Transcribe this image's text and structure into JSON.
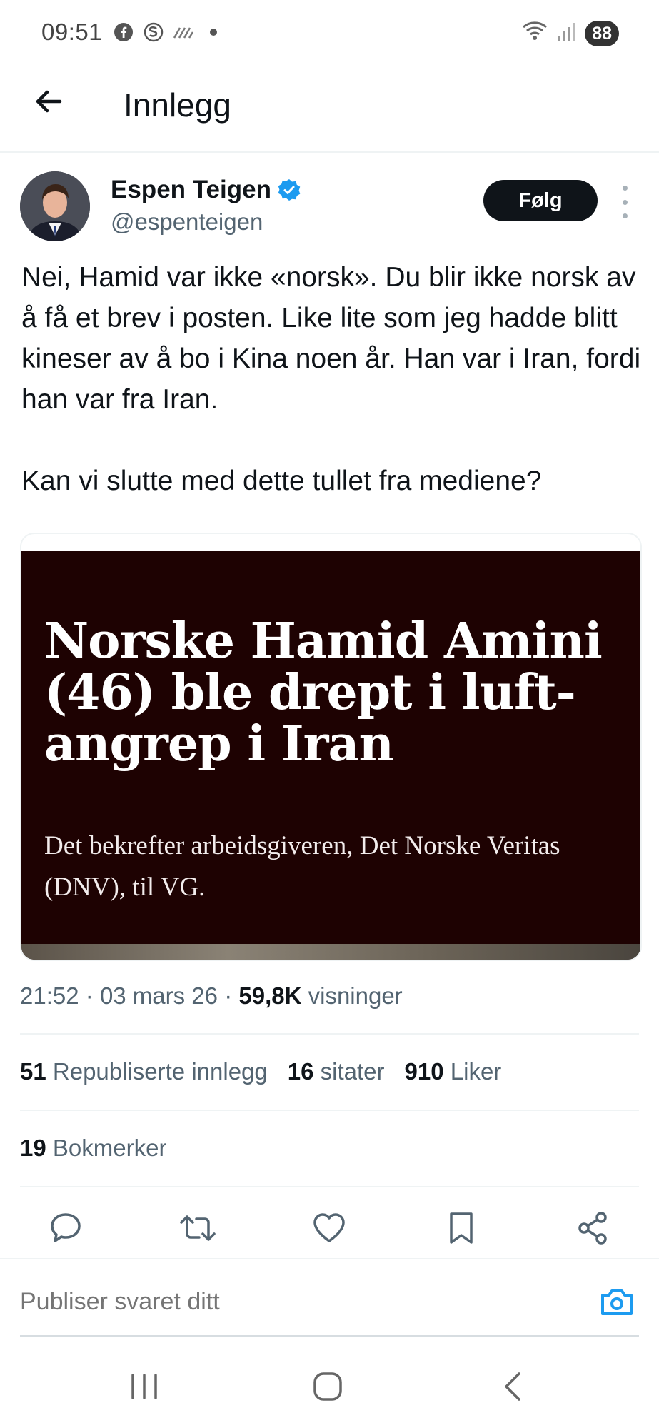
{
  "status_bar": {
    "time": "09:51",
    "icons": [
      "facebook-icon",
      "skype-icon",
      "signal-waves-icon",
      "dot-icon"
    ],
    "right_icons": [
      "wifi-icon",
      "cellular-signal-icon"
    ],
    "battery": "88"
  },
  "header": {
    "title": "Innlegg",
    "back_icon": "arrow-left-icon"
  },
  "author": {
    "name": "Espen Teigen",
    "handle": "@espenteigen",
    "verified": true,
    "follow_label": "Følg"
  },
  "tweet": {
    "paragraphs": [
      "Nei, Hamid var ikke «norsk». Du blir ikke norsk av å få et brev i posten. Like lite som jeg hadde blitt kineser av å bo i Kina noen år. Han var i Iran, fordi han var fra Iran.",
      "Kan vi slutte med dette tullet fra mediene?"
    ]
  },
  "card": {
    "headline": "Norske Hamid Amini (46) ble drept i luft-angrep i Iran",
    "subtitle": "Det bekrefter arbeidsgiveren, Det Norske Veritas (DNV), til VG."
  },
  "meta": {
    "time": "21:52",
    "separator": "·",
    "date": "03 mars 26",
    "views_count": "59,8K",
    "views_label": "visninger"
  },
  "stats": {
    "reposts_count": "51",
    "reposts_label": "Republiserte innlegg",
    "quotes_count": "16",
    "quotes_label": "sitater",
    "likes_count": "910",
    "likes_label": "Liker",
    "bookmarks_count": "19",
    "bookmarks_label": "Bokmerker"
  },
  "actions": [
    "reply-icon",
    "repost-icon",
    "like-icon",
    "bookmark-icon",
    "share-icon"
  ],
  "reply": {
    "placeholder": "Publiser svaret ditt"
  },
  "colors": {
    "text": "#0f1419",
    "secondary": "#536471",
    "accent": "#1d9bf0",
    "card_bg": "#1e0202",
    "follow_bg": "#0f1419"
  }
}
